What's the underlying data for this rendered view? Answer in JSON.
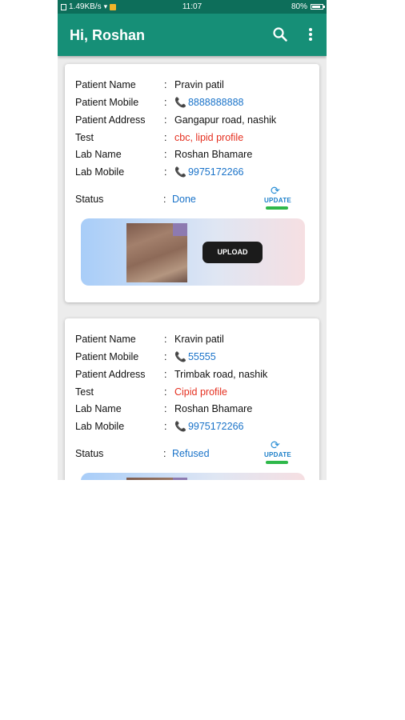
{
  "status_bar": {
    "network_speed": "1.49KB/s",
    "time": "11:07",
    "battery": "80%"
  },
  "app_bar": {
    "title": "Hi, Roshan",
    "search_icon": "search-icon",
    "menu_icon": "more-vert-icon"
  },
  "labels": {
    "patient_name": "Patient Name",
    "patient_mobile": "Patient Mobile",
    "patient_address": "Patient Address",
    "test": "Test",
    "lab_name": "Lab Name",
    "lab_mobile": "Lab Mobile",
    "status": "Status",
    "colon": ":",
    "update": "UPDATE",
    "upload": "UPLOAD"
  },
  "cards": [
    {
      "patient_name": "Pravin patil",
      "patient_mobile": "8888888888",
      "patient_address": "Gangapur road, nashik",
      "test": "cbc, lipid profile",
      "lab_name": "Roshan Bhamare",
      "lab_mobile": "9975172266",
      "status": "Done"
    },
    {
      "patient_name": "Kravin patil",
      "patient_mobile": "55555",
      "patient_address": "Trimbak road, nashik",
      "test": "Cipid profile",
      "lab_name": "Roshan Bhamare",
      "lab_mobile": "9975172266",
      "status": "Refused"
    }
  ],
  "colors": {
    "status_bar": "#0d6e5a",
    "app_bar": "#168f77",
    "link": "#1a73c9",
    "test": "#e53020"
  }
}
